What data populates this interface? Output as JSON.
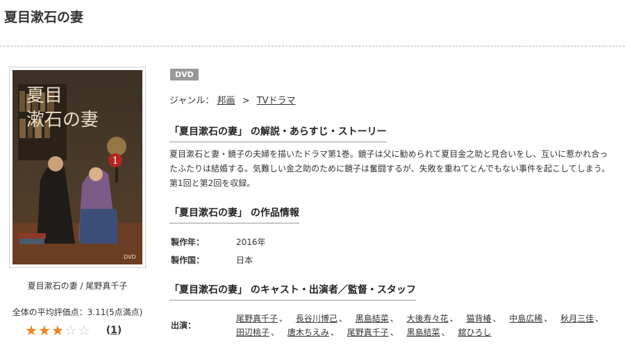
{
  "page": {
    "title": "夏目漱石の妻"
  },
  "cover": {
    "format_mark": "DVD",
    "cover_title": "夏目漱石の妻",
    "episode": "1"
  },
  "product": {
    "caption": "夏目漱石の妻 / 尾野真千子",
    "rating_text": "全体の平均評価点：3.11(5点満点)",
    "rating_value": 3.11,
    "rating_max": 5,
    "stars": {
      "filled": 3,
      "total": 5
    },
    "review_count_prefix": "(",
    "review_count": "1",
    "review_count_suffix": ")"
  },
  "badge": {
    "label": "DVD"
  },
  "genre": {
    "label": "ジャンル：",
    "items": [
      "邦画",
      "TVドラマ"
    ],
    "separator": ">"
  },
  "sections": {
    "synopsis_heading": "「夏目漱石の妻」 の解説・あらすじ・ストーリー",
    "info_heading": "「夏目漱石の妻」 の作品情報",
    "cast_heading": "「夏目漱石の妻」 のキャスト・出演者／監督・スタッフ"
  },
  "synopsis": "夏目漱石と妻・鏡子の夫婦を描いたドラマ第1巻。鏡子は父に勧められて夏目金之助と見合いをし、互いに惹かれ合ったふたりは結婚する。気難しい金之助のために鏡子は奮闘するが、失敗を重ねてとんでもない事件を起こしてしまう。第1回と第2回を収録。",
  "info": {
    "year_label": "製作年：",
    "year_value": "2016年",
    "country_label": "製作国：",
    "country_value": "日本"
  },
  "cast": {
    "label": "出演：",
    "names": [
      "尾野真千子",
      "長谷川博己",
      "黒島結菜",
      "大後寿々花",
      "猫背椿",
      "中島広稀",
      "秋月三佳",
      "田辺桃子",
      "唐木ちえみ",
      "尾野真千子",
      "黒島結菜",
      "舘ひろし"
    ],
    "separator": "、"
  }
}
